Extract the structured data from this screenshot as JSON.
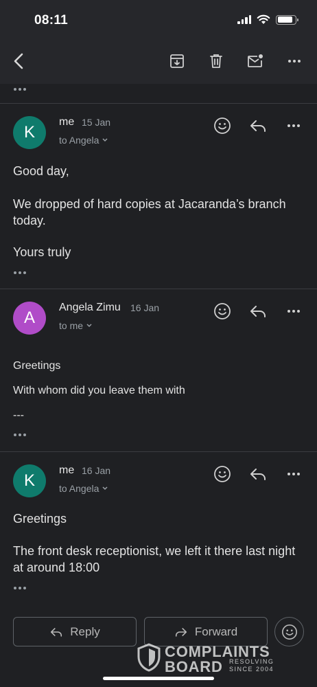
{
  "status": {
    "time": "08:11"
  },
  "toolbar": {
    "back_icon": "chevron-left-icon",
    "archive_icon": "archive-icon",
    "delete_icon": "trash-icon",
    "unread_icon": "mark-unread-icon",
    "more_icon": "more-horizontal-icon"
  },
  "messages": [
    {
      "avatar_letter": "K",
      "avatar_color": "#0f7b6c",
      "sender": "me",
      "date": "15 Jan",
      "to": "to Angela",
      "body": [
        "Good day,",
        "We dropped of hard copies at Jacaranda’s branch today.",
        "Yours truly"
      ]
    },
    {
      "avatar_letter": "A",
      "avatar_color": "#b04cc8",
      "sender": "Angela Zimu",
      "date": "16 Jan",
      "to": "to me",
      "body": [
        "Greetings",
        "With whom did you leave them with",
        "---"
      ]
    },
    {
      "avatar_letter": "K",
      "avatar_color": "#0f7b6c",
      "sender": "me",
      "date": "16 Jan",
      "to": "to Angela",
      "body": [
        "Greetings",
        "The front desk receptionist, we left it there last night at around 18:00"
      ]
    }
  ],
  "actions": {
    "reply_label": "Reply",
    "forward_label": "Forward"
  },
  "watermark": {
    "line1": "COMPLAINTS",
    "line2": "BOARD",
    "sub1": "RESOLVING",
    "sub2": "SINCE 2004"
  }
}
